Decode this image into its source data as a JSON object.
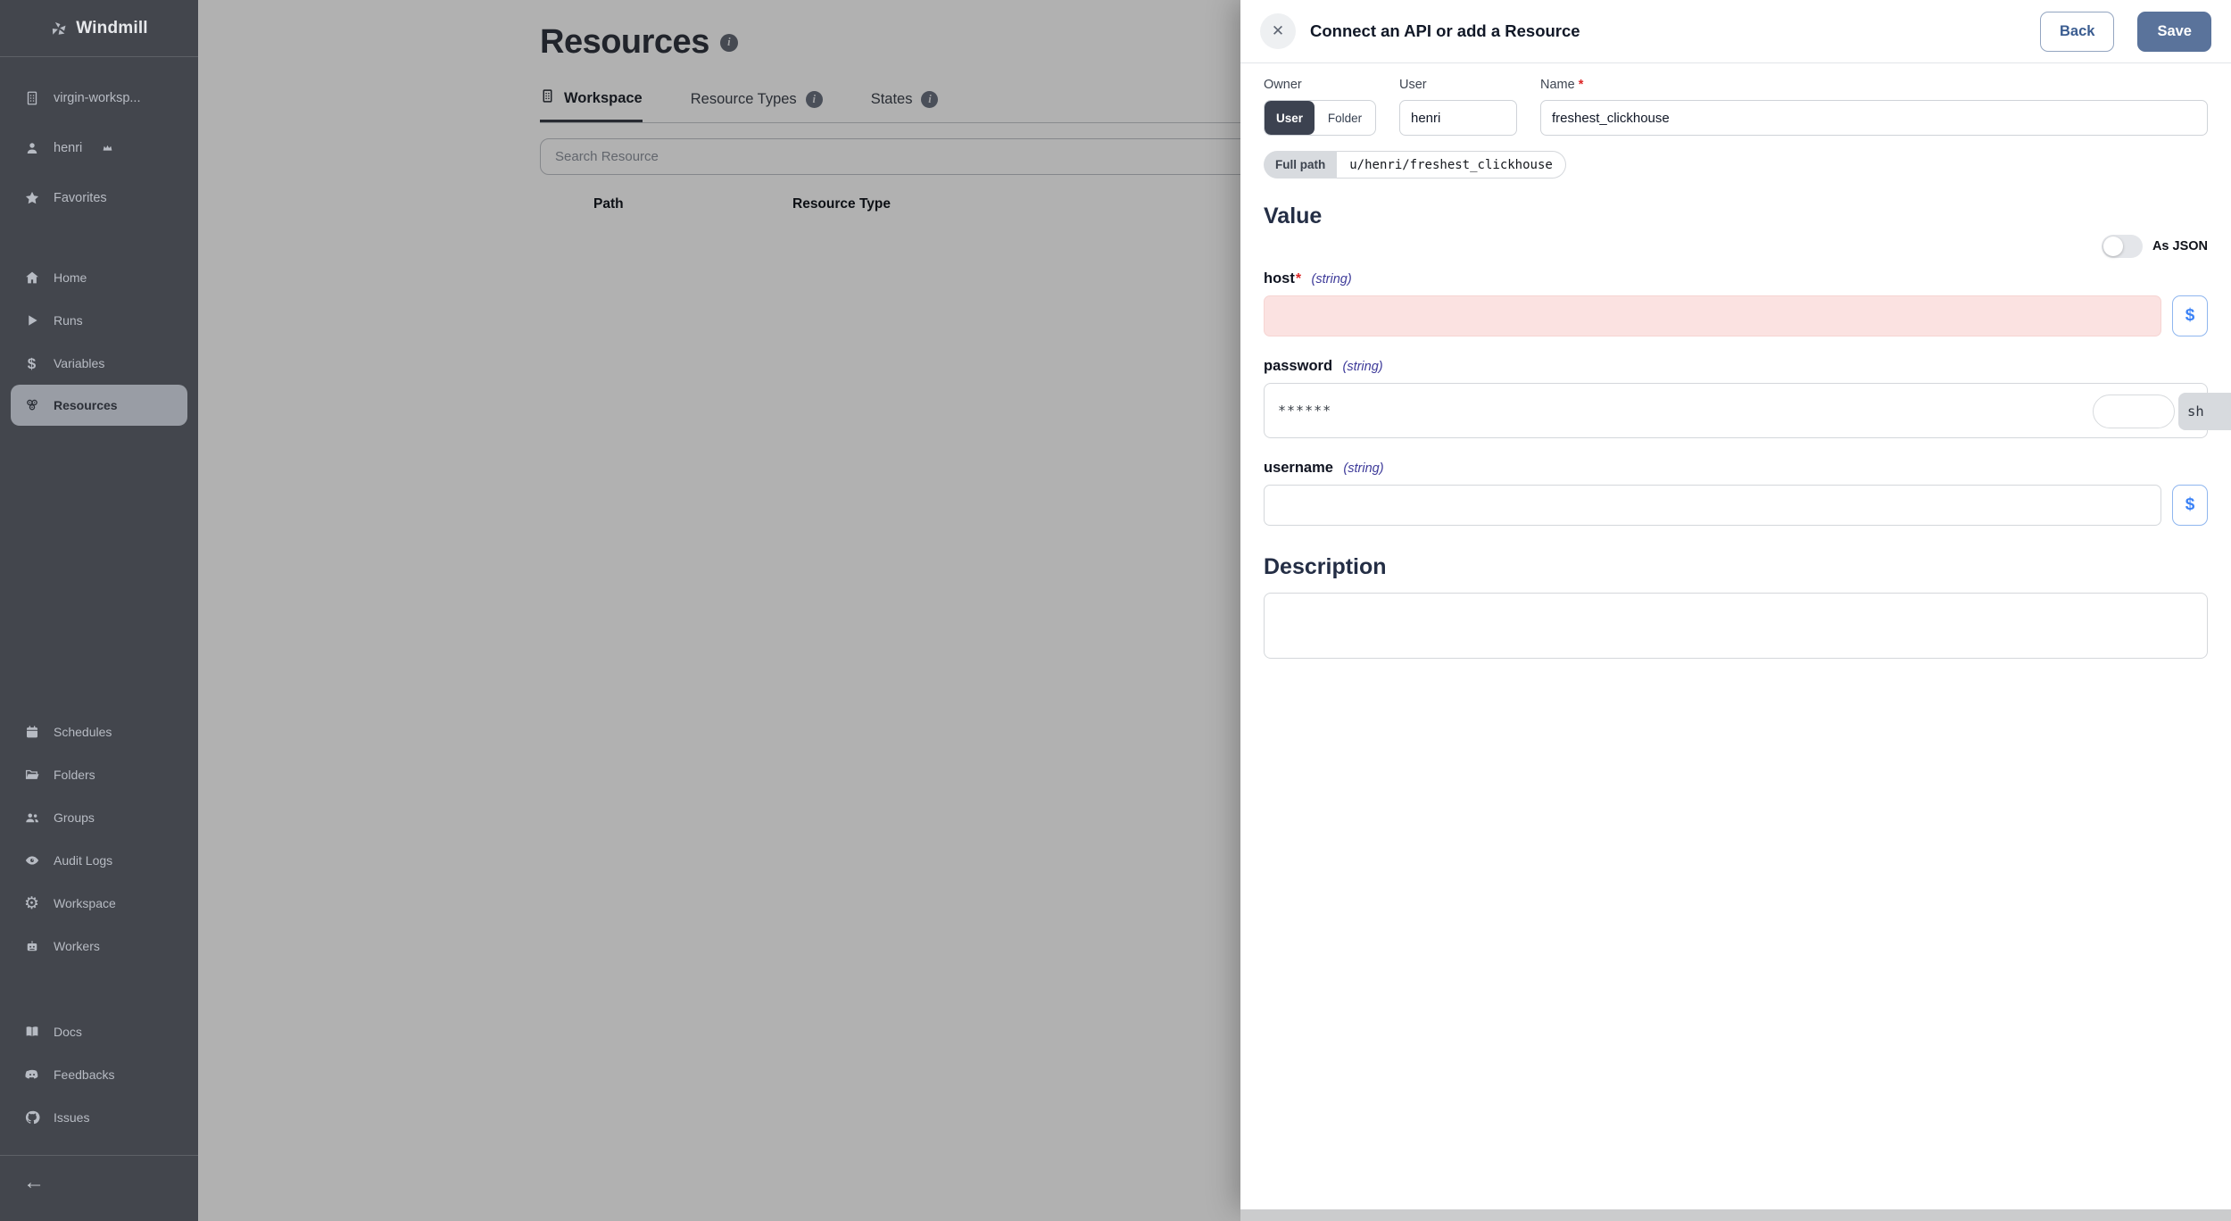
{
  "app": {
    "name": "Windmill"
  },
  "icons": {
    "close": "✕",
    "collapse_arrow": "←",
    "info": "i",
    "dollar": "$",
    "gear": "⚙"
  },
  "sidebar": {
    "workspace_switcher": "virgin-worksp...",
    "user": "henri",
    "favorites": "Favorites",
    "primary": [
      {
        "label": "Home"
      },
      {
        "label": "Runs"
      },
      {
        "label": "Variables"
      },
      {
        "label": "Resources"
      }
    ],
    "secondary": [
      {
        "label": "Schedules"
      },
      {
        "label": "Folders"
      },
      {
        "label": "Groups"
      },
      {
        "label": "Audit Logs"
      },
      {
        "label": "Workspace"
      },
      {
        "label": "Workers"
      }
    ],
    "external": [
      {
        "label": "Docs"
      },
      {
        "label": "Feedbacks"
      },
      {
        "label": "Issues"
      }
    ]
  },
  "main": {
    "title": "Resources",
    "tabs": [
      {
        "label": "Workspace"
      },
      {
        "label": "Resource Types"
      },
      {
        "label": "States"
      }
    ],
    "search_placeholder": "Search Resource",
    "columns": [
      "Path",
      "Resource Type"
    ]
  },
  "drawer": {
    "title": "Connect an API or add a Resource",
    "back": "Back",
    "save": "Save",
    "owner_label": "Owner",
    "owner_options": [
      "User",
      "Folder"
    ],
    "user_label": "User",
    "user_value": "henri",
    "name_label": "Name",
    "required_mark": "*",
    "name_value": "freshest_clickhouse",
    "full_path_label": "Full path",
    "full_path_value": "u/henri/freshest_clickhouse",
    "value_heading": "Value",
    "as_json_label": "As JSON",
    "type_string": "(string)",
    "host_label": "host",
    "password_label": "password",
    "password_value": "******",
    "password_addon": "sh",
    "username_label": "username",
    "description_heading": "Description"
  }
}
